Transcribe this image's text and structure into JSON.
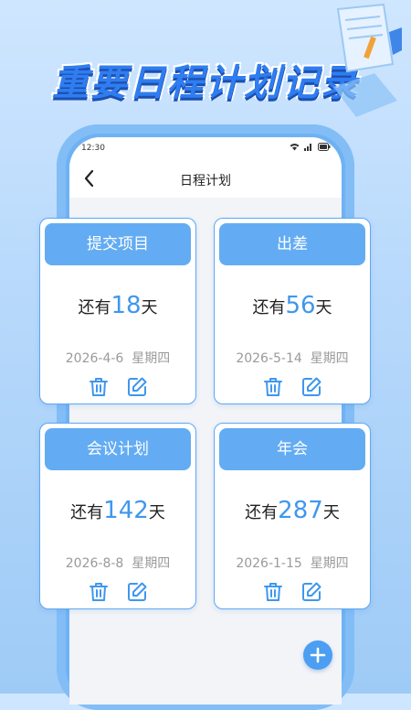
{
  "promo": {
    "title": "重要日程计划记录"
  },
  "status": {
    "time": "12:30"
  },
  "nav": {
    "title": "日程计划"
  },
  "cards": [
    {
      "title": "提交项目",
      "prefix": "还有",
      "days": "18",
      "suffix": "天",
      "date": "2026-4-6",
      "weekday": "星期四"
    },
    {
      "title": "出差",
      "prefix": "还有",
      "days": "56",
      "suffix": "天",
      "date": "2026-5-14",
      "weekday": "星期四"
    },
    {
      "title": "会议计划",
      "prefix": "还有",
      "days": "142",
      "suffix": "天",
      "date": "2026-8-8",
      "weekday": "星期四"
    },
    {
      "title": "年会",
      "prefix": "还有",
      "days": "287",
      "suffix": "天",
      "date": "2026-1-15",
      "weekday": "星期四"
    }
  ],
  "icons": {
    "back": "chevron-left-icon",
    "delete": "trash-icon",
    "edit": "edit-icon",
    "add": "plus-icon"
  },
  "colors": {
    "accent": "#63acf3",
    "number": "#3f97ee",
    "background": "#b6d8fb"
  }
}
